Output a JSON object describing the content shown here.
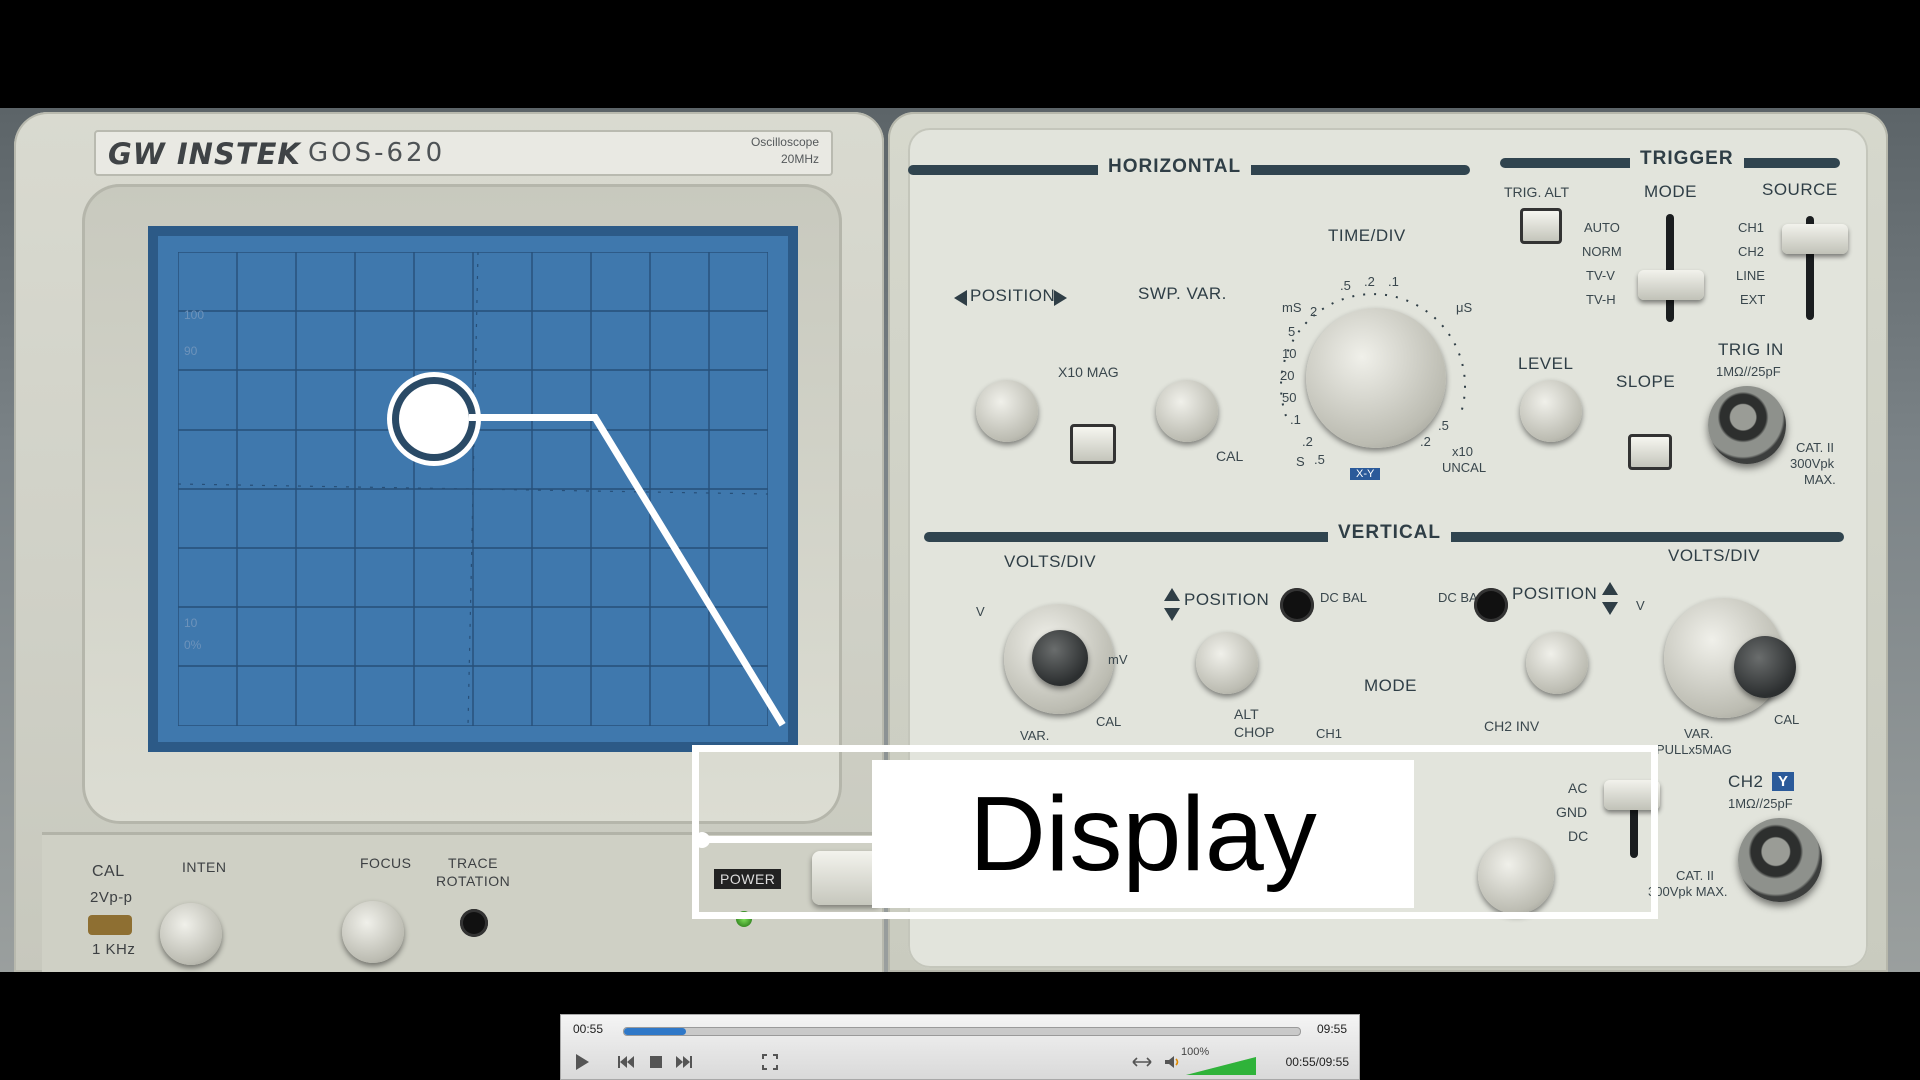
{
  "device": {
    "brand": "GW INSTEK",
    "model": "GOS-620",
    "subtitle_line1": "Oscilloscope",
    "subtitle_line2": "20MHz"
  },
  "screen": {
    "labels": [
      "100",
      "90",
      "10",
      "0%"
    ]
  },
  "front_controls": {
    "cal": "CAL",
    "cal_value": "2Vp-p",
    "cal_freq": "1 KHz",
    "inten": "INTEN",
    "focus": "FOCUS",
    "trace_rotation_1": "TRACE",
    "trace_rotation_2": "ROTATION",
    "power": "POWER"
  },
  "horizontal": {
    "title": "HORIZONTAL",
    "position": "POSITION",
    "swp_var": "SWP. VAR.",
    "x10_mag": "X10  MAG",
    "cal": "CAL",
    "time_div": "TIME/DIV",
    "ms": "mS",
    "us": "μS",
    "x10": "x10",
    "uncal": "UNCAL",
    "xy": "X-Y",
    "ticks": [
      "2",
      ".5",
      ".2",
      ".1",
      "5",
      "10",
      "20",
      "50",
      ".1",
      ".2",
      "S",
      ".5",
      ".5",
      ".2"
    ]
  },
  "trigger": {
    "title": "TRIGGER",
    "trig_alt": "TRIG. ALT",
    "mode": "MODE",
    "source": "SOURCE",
    "modes": [
      "AUTO",
      "NORM",
      "TV-V",
      "TV-H"
    ],
    "sources": [
      "CH1",
      "CH2",
      "LINE",
      "EXT"
    ],
    "level": "LEVEL",
    "slope": "SLOPE",
    "trig_in": "TRIG IN",
    "trig_in_spec": "1MΩ//25pF",
    "cat": "CAT. II",
    "cat_v": "300Vpk",
    "cat_max": "MAX."
  },
  "vertical": {
    "title": "VERTICAL",
    "volts_div_l": "VOLTS/DIV",
    "volts_div_r": "VOLTS/DIV",
    "position_l": "POSITION",
    "position_r": "POSITION",
    "dc_bal_l": "DC BAL",
    "dc_bal_r": "DC BAL",
    "var": "VAR.",
    "pullx5": "PULLx5MAG",
    "alt": "ALT",
    "chop": "CHOP",
    "mode": "MODE",
    "ch1": "CH1",
    "ch2_inv": "CH2  INV",
    "ac": "AC",
    "gnd": "GND",
    "dc": "DC",
    "ch2": "CH2",
    "ch2_y": "Y",
    "ch2_spec": "1MΩ//25pF",
    "cat": "CAT. II",
    "cat_v": "300Vpk  MAX.",
    "mv": "mV",
    "v": "V",
    "cal": "CAL"
  },
  "annotation": {
    "label": "Display"
  },
  "player": {
    "elapsed": "00:55",
    "total": "09:55",
    "position_time": "00:55/09:55",
    "volume": "100%",
    "progress": 0.0924,
    "volume_level": 1.0
  }
}
